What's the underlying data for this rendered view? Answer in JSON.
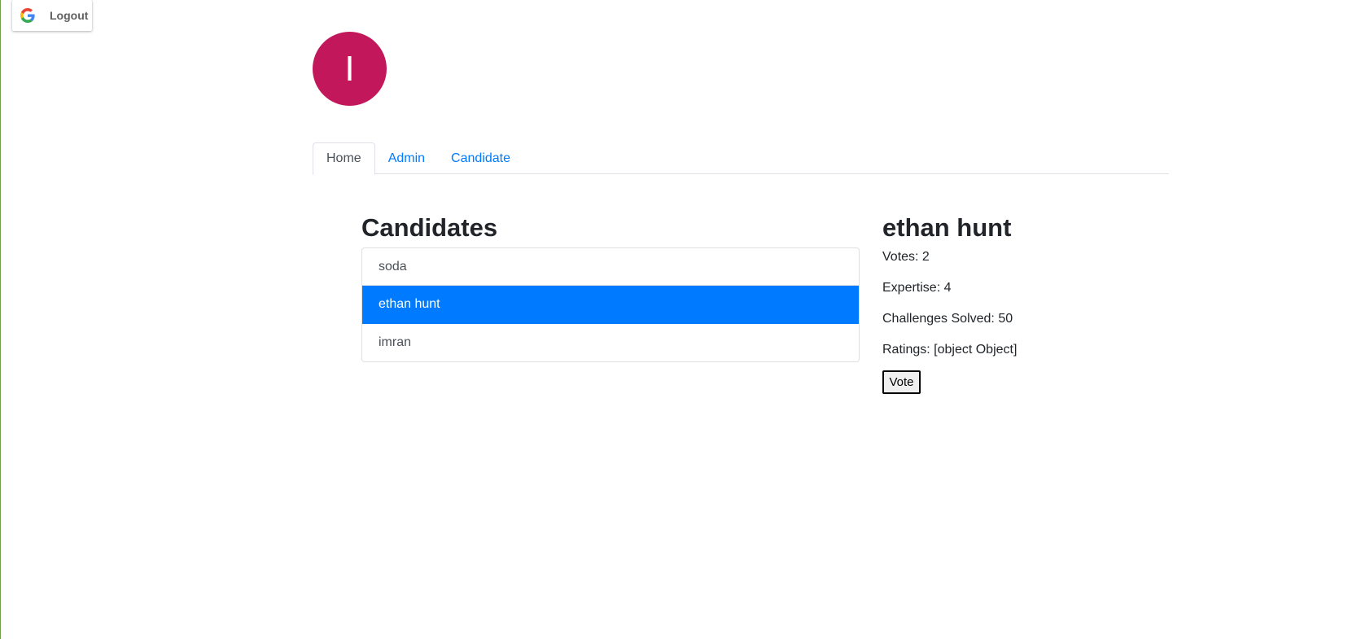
{
  "auth": {
    "logout_label": "Logout",
    "icon": "google-icon"
  },
  "profile": {
    "avatar_initial": "I",
    "avatar_color": "#c2185b"
  },
  "tabs": [
    {
      "label": "Home",
      "active": true
    },
    {
      "label": "Admin",
      "active": false
    },
    {
      "label": "Candidate",
      "active": false
    }
  ],
  "candidates": {
    "title": "Candidates",
    "items": [
      {
        "name": "soda",
        "selected": false
      },
      {
        "name": "ethan hunt",
        "selected": true
      },
      {
        "name": "imran",
        "selected": false
      }
    ],
    "accent_color": "#007bff"
  },
  "detail": {
    "name": "ethan hunt",
    "votes": "Votes: 2",
    "expertise": "Expertise: 4",
    "challenges": "Challenges Solved: 50",
    "ratings": "Ratings: [object Object]",
    "vote_label": "Vote"
  }
}
